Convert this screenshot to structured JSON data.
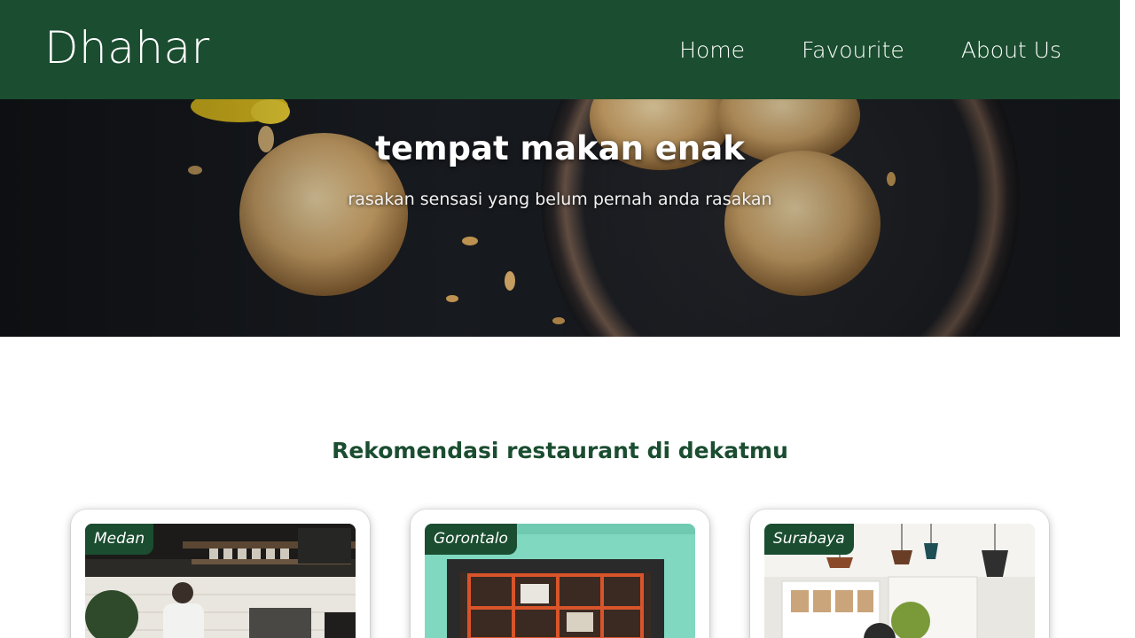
{
  "header": {
    "brand": "Dhahar",
    "nav": [
      {
        "label": "Home"
      },
      {
        "label": "Favourite"
      },
      {
        "label": "About Us"
      }
    ],
    "background_color": "#1b4d30"
  },
  "hero": {
    "title": "tempat makan enak",
    "subtitle": "rasakan sensasi yang belum pernah anda rasakan"
  },
  "section": {
    "title": "Rekomendasi restaurant di dekatmu"
  },
  "cards": [
    {
      "city": "Medan"
    },
    {
      "city": "Gorontalo"
    },
    {
      "city": "Surabaya"
    }
  ],
  "colors": {
    "primary": "#1b4d30",
    "white": "#ffffff"
  }
}
